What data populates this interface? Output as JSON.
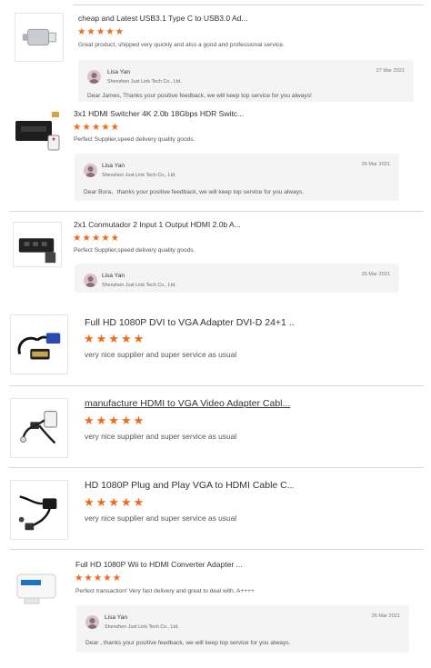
{
  "reviews": [
    {
      "title": "cheap and Latest USB3.1 Type C to USB3.0 Ad...",
      "stars": "★★★★★",
      "comment": "Great product, shipped very quickly and also a good and professional service.",
      "reply": {
        "name": "Lisa Yan",
        "company": "Shenzhen Just Link Tech Co., Ltd.",
        "date": "27 Mar 2021",
        "text": "Dear James, Thanks your positive feedback, we will keep top service for you always!"
      }
    },
    {
      "title": "3x1 HDMI Switcher 4K 2.0b 18Gbps HDR Switc...",
      "stars": "★★★★★",
      "comment": "Perfect Supplier,speed delivery quality goods.",
      "reply": {
        "name": "Lisa Yan",
        "company": "Shenzhen Just Link Tech Co., Ltd.",
        "date": "26 Mar 2021",
        "text": "Dear Bora、thanks your positive feedback, we will keep top service for you always."
      }
    },
    {
      "title": "2x1 Conmutador 2 Input 1 Output HDMI 2.0b A...",
      "stars": "★★★★★",
      "comment": "Perfect Supplier,speed delivery quality goods.",
      "reply": {
        "name": "Lisa Yan",
        "company": "Shenzhen Just Link Tech Co., Ltd.",
        "date": "26 Mar 2021",
        "text": ""
      }
    },
    {
      "title": "Full HD 1080P DVI to VGA Adapter DVI-D 24+1 ...",
      "stars": "★★★★★",
      "comment": "very nice supplier and super service as usual"
    },
    {
      "title": "manufacture HDMI to VGA Video Adapter Cabl...",
      "stars": "★★★★★",
      "comment": "very nice supplier and super service as usual"
    },
    {
      "title": "HD 1080P Plug and Play VGA to HDMI Cable C...",
      "stars": "★★★★★",
      "comment": "very nice supplier and super service as usual"
    },
    {
      "title": "Full HD 1080P Wii to HDMI Converter Adapter ...",
      "stars": "★★★★★",
      "comment": "Perfect transaction! Very fast delivery and great to deal with. A++++",
      "reply": {
        "name": "Lisa Yan",
        "company": "Shenzhen Just Link Tech Co., Ltd.",
        "date": "26 Mar 2021",
        "text": "Dear , thanks your positive feedback, we will keep top service for you always."
      }
    }
  ],
  "colors": {
    "star": "#ef6a1a",
    "reply_bg": "#f4f4f4",
    "divider": "#d9d9d9"
  }
}
